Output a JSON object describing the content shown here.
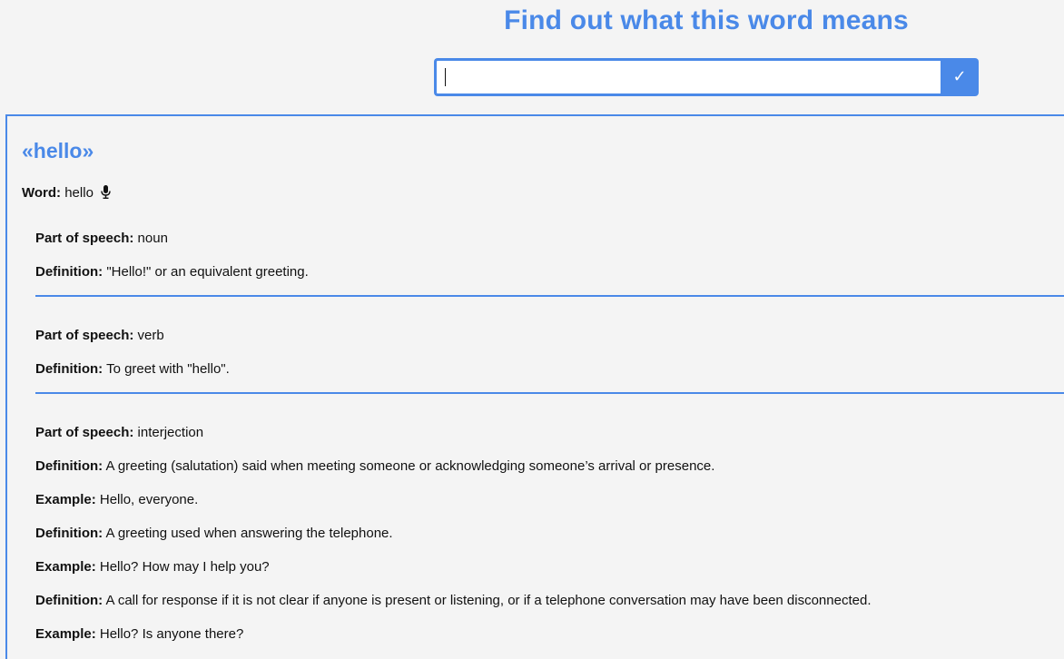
{
  "header": {
    "title": "Find out what this word means",
    "search_value": "",
    "search_button_label": "✓"
  },
  "result": {
    "title": "«hello»",
    "word_label": "Word:",
    "word_value": "hello",
    "audio_icon": "microphone-icon",
    "accent_color": "#4a89e8",
    "labels": {
      "part_of_speech": "Part of speech:",
      "definition": "Definition:",
      "example": "Example:"
    },
    "meanings": [
      {
        "part_of_speech": "noun",
        "definitions": [
          {
            "definition": "\"Hello!\" or an equivalent greeting."
          }
        ]
      },
      {
        "part_of_speech": "verb",
        "definitions": [
          {
            "definition": "To greet with \"hello\"."
          }
        ]
      },
      {
        "part_of_speech": "interjection",
        "definitions": [
          {
            "definition": "A greeting (salutation) said when meeting someone or acknowledging someone’s arrival or presence.",
            "example": "Hello, everyone."
          },
          {
            "definition": "A greeting used when answering the telephone.",
            "example": "Hello? How may I help you?"
          },
          {
            "definition": "A call for response if it is not clear if anyone is present or listening, or if a telephone conversation may have been disconnected.",
            "example": "Hello? Is anyone there?"
          }
        ]
      }
    ]
  }
}
